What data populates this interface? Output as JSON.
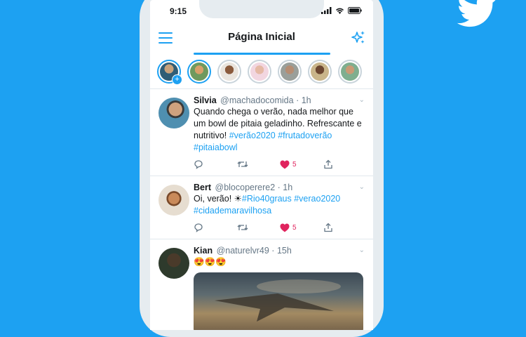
{
  "colors": {
    "accent": "#1da1f2",
    "like": "#e0245e",
    "background": "#1da1f2"
  },
  "status": {
    "time": "9:15"
  },
  "header": {
    "title": "Página Inicial"
  },
  "stories": {
    "count": 7
  },
  "tweets": [
    {
      "name": "Silvia",
      "handle": "@machadocomida",
      "time": "1h",
      "text": "Quando chega o verão, nada melhor que um bowl de pitaia geladinho. Refrescante e nutritivo! ",
      "tags": "#verão2020 #frutadoverão #pitaiabowl",
      "likes": "5"
    },
    {
      "name": "Bert",
      "handle": "@blocoperere2",
      "time": "1h",
      "text": "Oi, verão! ☀",
      "tags": "#Rio40graus #verao2020 #cidademaravilhosa",
      "likes": "5"
    },
    {
      "name": "Kian",
      "handle": "@naturelvr49",
      "time": "15h",
      "text": "😍😍😍"
    }
  ]
}
